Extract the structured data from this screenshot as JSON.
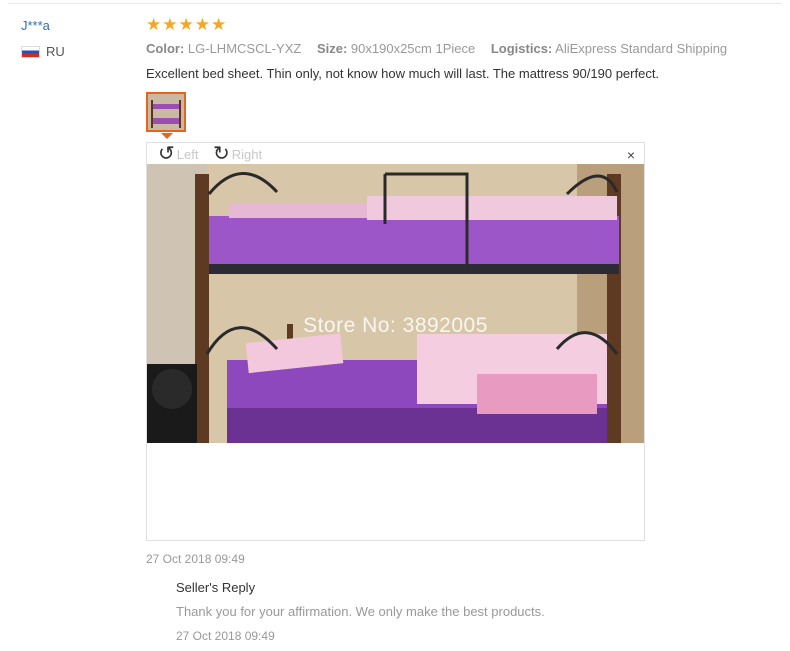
{
  "review": {
    "user": "J***a",
    "country_code": "RU",
    "rating_stars": 5,
    "star_color": "#f5a623",
    "meta": {
      "color_label": "Color:",
      "color_value": "LG-LHMCSCL-YXZ",
      "size_label": "Size:",
      "size_value": "90x190x25cm 1Piece",
      "logistics_label": "Logistics:",
      "logistics_value": "AliExpress Standard Shipping"
    },
    "text": "Excellent bed sheet. Thin only, not know how much will last. The mattress 90/190 perfect.",
    "viewer": {
      "rotate_left_label": "Left",
      "rotate_right_label": "Right",
      "close_icon": "×",
      "watermark": "Store No: 3892005"
    },
    "date": "27 Oct 2018 09:49"
  },
  "seller_reply": {
    "title": "Seller's Reply",
    "text": "Thank you for your affirmation. We only make the best products.",
    "date": "27 Oct 2018 09:49"
  },
  "colors": {
    "username": "#2f6fb2",
    "thumb_border": "#e5641e"
  }
}
